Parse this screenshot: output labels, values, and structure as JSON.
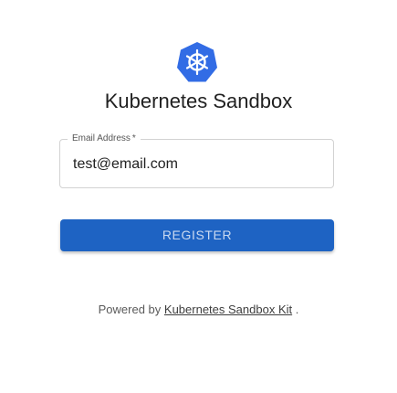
{
  "app": {
    "title": "Kubernetes Sandbox",
    "logo_icon": "kubernetes-helm-icon"
  },
  "form": {
    "email_label": "Email Address",
    "email_required_marker": "*",
    "email_value": "test@email.com",
    "register_label": "REGISTER"
  },
  "footer": {
    "prefix": "Powered by",
    "link_text": "Kubernetes Sandbox Kit",
    "suffix": "."
  },
  "colors": {
    "logo_blue": "#326ce5",
    "button_blue": "#1e63c3",
    "border": "#d2d2d2"
  }
}
